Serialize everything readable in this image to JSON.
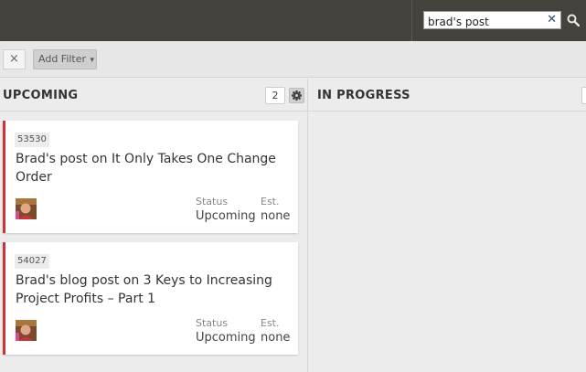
{
  "search": {
    "value": "brad's post",
    "clear_icon": "close-icon",
    "search_icon": "magnifier-icon"
  },
  "filters": {
    "clear_label": "×",
    "add_filter_label": "Add Filter",
    "chevron": "▾"
  },
  "columns": [
    {
      "title": "UPCOMING",
      "count": "2",
      "cards": [
        {
          "id": "53530",
          "title": "Brad's post on It Only Takes One Change Order",
          "status_label": "Status",
          "status": "Upcoming",
          "est_label": "Est.",
          "est": "none",
          "accent": "#c9353b"
        },
        {
          "id": "54027",
          "title": "Brad's blog post on 3 Keys to Increasing Project Profits – Part 1",
          "status_label": "Status",
          "status": "Upcoming",
          "est_label": "Est.",
          "est": "none",
          "accent": "#c9353b"
        }
      ]
    },
    {
      "title": "IN PROGRESS"
    }
  ],
  "colors": {
    "topbar": "#46423d",
    "card_accent": "#c9353b",
    "clear_icon": "#2b4f7c"
  }
}
